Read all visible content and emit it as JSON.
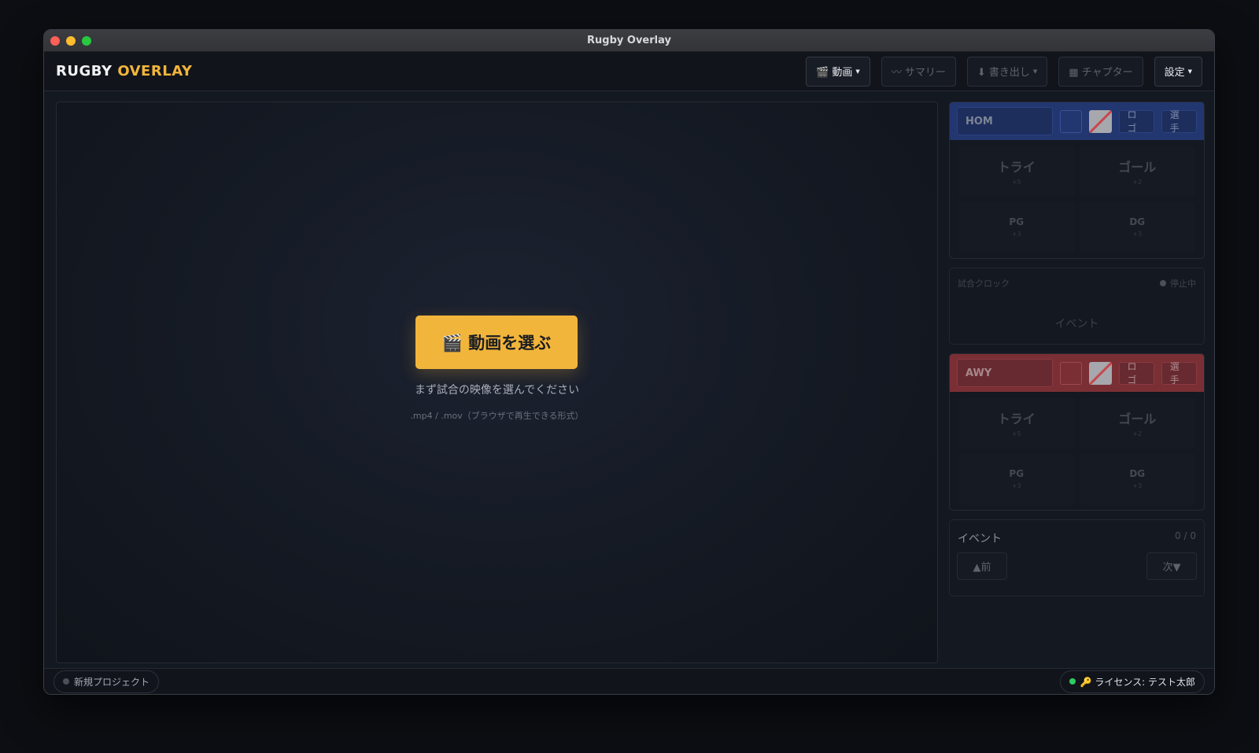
{
  "window": {
    "title": "Rugby Overlay"
  },
  "brand": {
    "part1": "RUGBY",
    "part2": "OVERLAY",
    "accent": "#f2b53b"
  },
  "toolbar": {
    "video": "🎬 動画",
    "summary": "〰 サマリー",
    "export": "⬇ 書き出し",
    "chapter": "▦ チャプター",
    "settings": "設定"
  },
  "video_area": {
    "pick_button": "🎬 動画を選ぶ",
    "hint": "まず試合の映像を選んでください",
    "formats": ".mp4 / .mov（ブラウザで再生できる形式）"
  },
  "home": {
    "name": "HOM",
    "color": "#22366f",
    "logo_label": "ロゴ",
    "players_label": "選手",
    "scores": [
      {
        "label": "トライ",
        "points": "+5"
      },
      {
        "label": "ゴール",
        "points": "+2"
      },
      {
        "label": "PG",
        "points": "+3"
      },
      {
        "label": "DG",
        "points": "+3"
      }
    ]
  },
  "clock": {
    "label": "試合クロック",
    "status": "停止中",
    "event": "イベント"
  },
  "away": {
    "name": "AWY",
    "color": "#7a2f35",
    "logo_label": "ロゴ",
    "players_label": "選手",
    "scores": [
      {
        "label": "トライ",
        "points": "+5"
      },
      {
        "label": "ゴール",
        "points": "+2"
      },
      {
        "label": "PG",
        "points": "+3"
      },
      {
        "label": "DG",
        "points": "+3"
      }
    ]
  },
  "events": {
    "title": "イベント",
    "count": "0 / 0",
    "prev": "▲前",
    "next": "次▼"
  },
  "status": {
    "project": "新規プロジェクト",
    "license": "🔑 ライセンス: テスト太郎"
  }
}
